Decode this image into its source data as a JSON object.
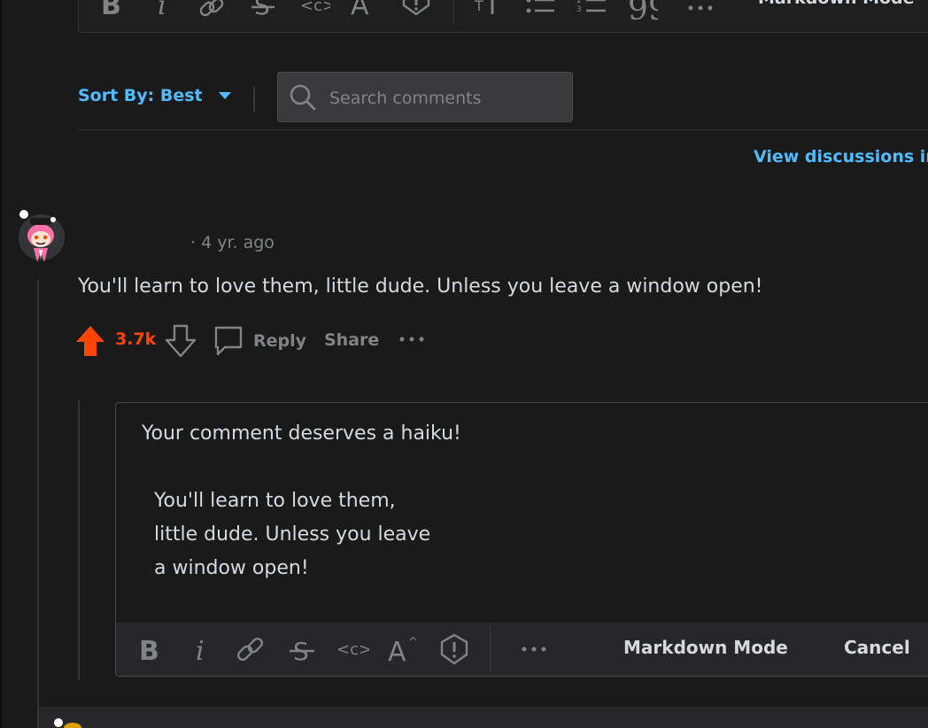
{
  "top_toolbar": {
    "icons": [
      "bold-icon",
      "italic-icon",
      "link-icon",
      "strikethrough-icon",
      "inline-code-icon",
      "superscript-icon",
      "spoiler-icon",
      "heading-icon",
      "bulleted-list-icon",
      "numbered-list-icon",
      "quote-icon",
      "more-icon"
    ],
    "markdown_mode": "Markdown Mode"
  },
  "sort": {
    "label": "Sort By: Best"
  },
  "search": {
    "placeholder": "Search comments"
  },
  "view_discussions": "View discussions in",
  "comment": {
    "time": "· 4 yr. ago",
    "body": "You'll learn to love them, little dude. Unless you leave a window open!",
    "votes": "3.7k",
    "reply_label": "Reply",
    "share_label": "Share"
  },
  "reply_editor": {
    "text": "Your comment deserves a haiku!\n\n  You'll learn to love them,\n  little dude. Unless you leave\n  a window open!",
    "markdown_mode": "Markdown Mode",
    "cancel": "Cancel"
  },
  "colors": {
    "accent": "#4fbcff",
    "upvote": "#ff4500",
    "background": "#1a1a1b",
    "muted": "#818384"
  }
}
